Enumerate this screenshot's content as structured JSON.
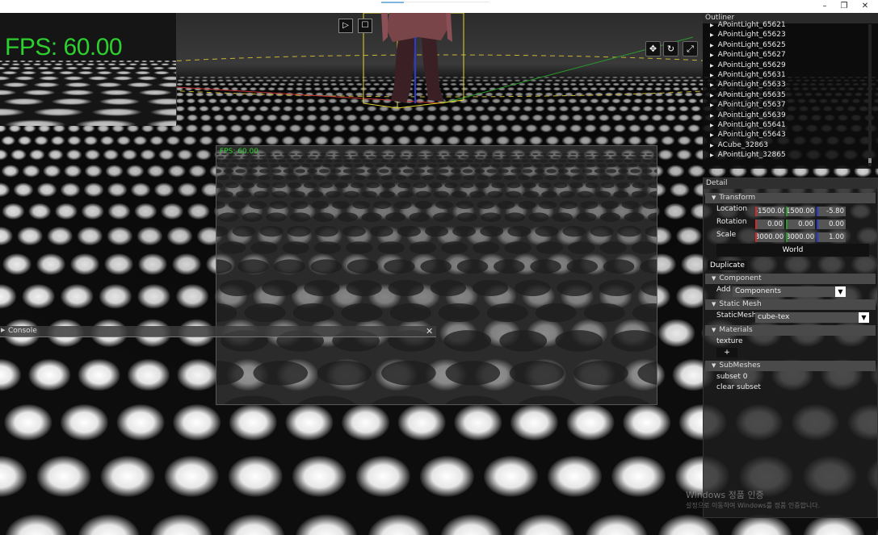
{
  "window": {
    "controls": {
      "minimize": "–",
      "maximize": "❐",
      "close": "✕"
    }
  },
  "viewport": {
    "mini_fps": "FPS: 60.00",
    "sub_fps": "FPS: 60.00",
    "toolbar": {
      "play_icon": "▷",
      "stop_icon": "☐"
    },
    "gizmo": {
      "move_icon": "✥",
      "rotate_icon": "↻",
      "scale_icon": "⤢"
    }
  },
  "console": {
    "title": "Console",
    "close_icon": "✕",
    "collapse_icon": "▶"
  },
  "outliner": {
    "title": "Outliner",
    "items": [
      "APointLight_65621",
      "APointLight_65623",
      "APointLight_65625",
      "APointLight_65627",
      "APointLight_65629",
      "APointLight_65631",
      "APointLight_65633",
      "APointLight_65635",
      "APointLight_65637",
      "APointLight_65639",
      "APointLight_65641",
      "APointLight_65643",
      "ACube_32863",
      "APointLight_32865"
    ]
  },
  "detail": {
    "title": "Detail",
    "transform": {
      "header": "Transform",
      "location_label": "Location",
      "rotation_label": "Rotation",
      "scale_label": "Scale",
      "location": [
        "-1500.00",
        "1500.00",
        "-5.80"
      ],
      "rotation": [
        "0.00",
        "0.00",
        "0.00"
      ],
      "scale": [
        "3000.00",
        "3000.00",
        "1.00"
      ],
      "space_button": "World"
    },
    "duplicate_button": "Duplicate",
    "component": {
      "header": "Component",
      "add_label": "Add",
      "add_value": "Components"
    },
    "static_mesh": {
      "header": "Static Mesh",
      "label": "StaticMesh",
      "value": "cube-tex"
    },
    "materials": {
      "header": "Materials",
      "item": "texture",
      "add_button": "+"
    },
    "submeshes": {
      "header": "SubMeshes",
      "item": "subset 0",
      "clear_button": "clear subset"
    },
    "colors": {
      "x_axis": "#d22a2a",
      "y_axis": "#2a9b2a",
      "z_axis": "#2a3bd2"
    }
  },
  "watermark": {
    "line1": "Windows 정품 인증",
    "line2": "설정으로 이동하여 Windows를 정품 인증합니다."
  }
}
